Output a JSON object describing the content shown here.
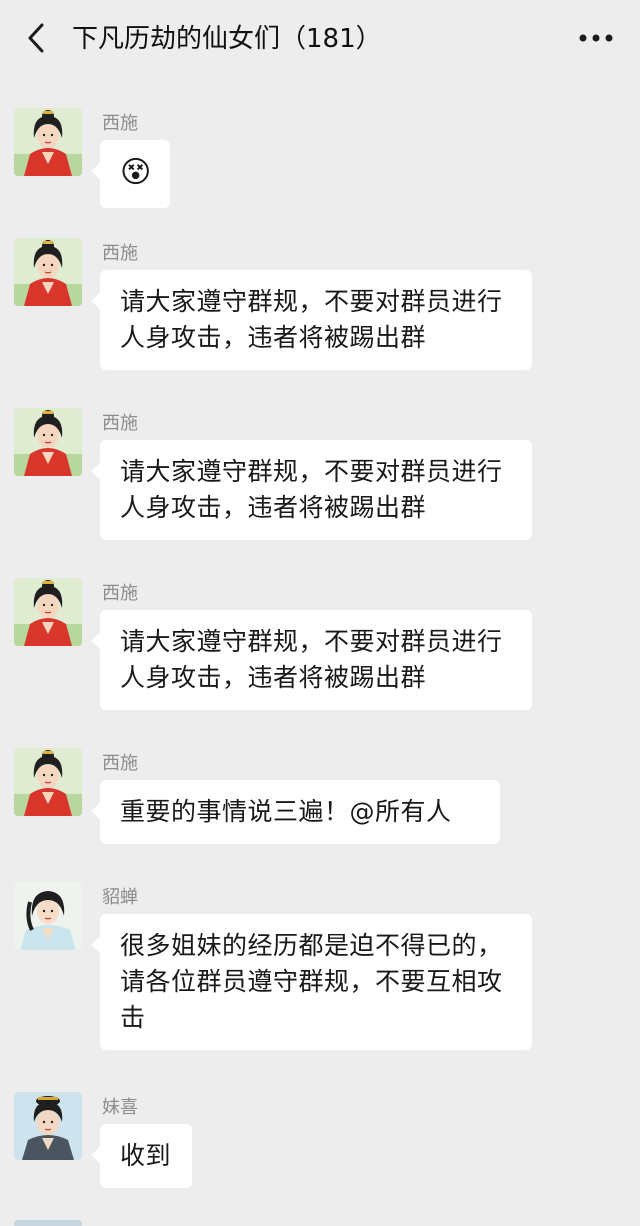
{
  "header": {
    "title": "下凡历劫的仙女们（181）"
  },
  "messages": [
    {
      "sender": "西施",
      "text": "😵"
    },
    {
      "sender": "西施",
      "text": "请大家遵守群规，不要对群员进行人身攻击，违者将被踢出群"
    },
    {
      "sender": "西施",
      "text": "请大家遵守群规，不要对群员进行人身攻击，违者将被踢出群"
    },
    {
      "sender": "西施",
      "text": "请大家遵守群规，不要对群员进行人身攻击，违者将被踢出群"
    },
    {
      "sender": "西施",
      "text": "重要的事情说三遍！@所有人"
    },
    {
      "sender": "貂蝉",
      "text": "很多姐妹的经历都是迫不得已的，请各位群员遵守群规，不要互相攻击"
    },
    {
      "sender": "妹喜",
      "text": "收到"
    }
  ],
  "icons": {
    "back": "chevron-left-icon",
    "more": "more-dots-icon"
  }
}
